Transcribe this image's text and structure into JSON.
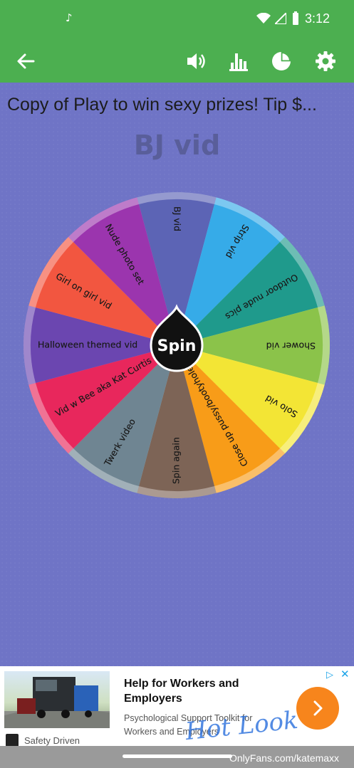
{
  "status_bar": {
    "time": "3:12",
    "notification_icon": "music-note-icon"
  },
  "app_bar": {
    "icons": [
      "back-arrow-icon",
      "volume-icon",
      "bar-chart-icon",
      "pie-chart-icon",
      "settings-gear-icon"
    ]
  },
  "wheel_title": "Copy of Play to win sexy prizes! Tip $...",
  "result": "BJ vid",
  "wheel": {
    "spin_label": "Spin",
    "segments": [
      {
        "label": "BJ vid",
        "color": "#5c64b5"
      },
      {
        "label": "Strip vid",
        "color": "#36abe8"
      },
      {
        "label": "Outdoor nude pics",
        "color": "#1f9a8c"
      },
      {
        "label": "Shower vid",
        "color": "#8bc34a"
      },
      {
        "label": "Solo vid",
        "color": "#f3e535"
      },
      {
        "label": "Close up pussy/bootyhole",
        "color": "#f89c18"
      },
      {
        "label": "Spin again",
        "color": "#7d6456"
      },
      {
        "label": "Twerk video",
        "color": "#6f8592"
      },
      {
        "label": "Vid w Bee aka Kat Curtis",
        "color": "#e8275c"
      },
      {
        "label": "Halloween themed vid",
        "color": "#6b46b0"
      },
      {
        "label": "Girl on girl vid",
        "color": "#f25640"
      },
      {
        "label": "Nude photo set",
        "color": "#9b35ae"
      }
    ]
  },
  "ad": {
    "headline": "Help for Workers and Employers",
    "description": "Psychological Support Toolkit for Workers and Employers",
    "advertiser": "Safety Driven",
    "cta_icon": "chevron-right-icon",
    "adchoices_icon": "adchoices-icon",
    "close_label": "✕"
  },
  "watermark": {
    "text": "OnlyFans.com/katemaxx",
    "signature": "Hot Look"
  }
}
